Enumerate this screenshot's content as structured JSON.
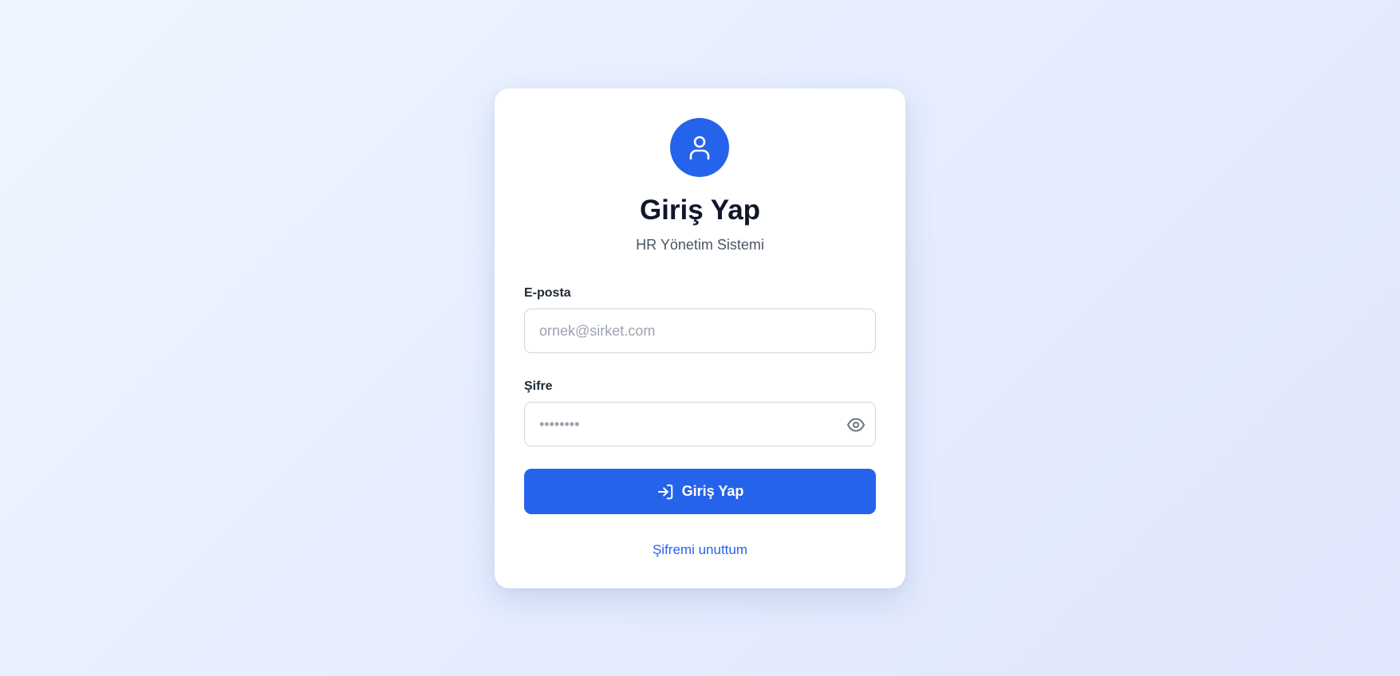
{
  "header": {
    "icon": "user-icon",
    "title": "Giriş Yap",
    "subtitle": "HR Yönetim Sistemi"
  },
  "form": {
    "email": {
      "label": "E-posta",
      "value": "",
      "placeholder": "ornek@sirket.com"
    },
    "password": {
      "label": "Şifre",
      "value": "",
      "placeholder": "••••••••",
      "toggle_icon": "eye-icon"
    },
    "submit": {
      "icon": "log-in-icon",
      "label": "Giriş Yap"
    },
    "forgot_link": "Şifremi unuttum"
  },
  "colors": {
    "accent": "#2563eb",
    "title": "#0f172a",
    "subtitle": "#4b5563",
    "border": "#d1d5db"
  }
}
